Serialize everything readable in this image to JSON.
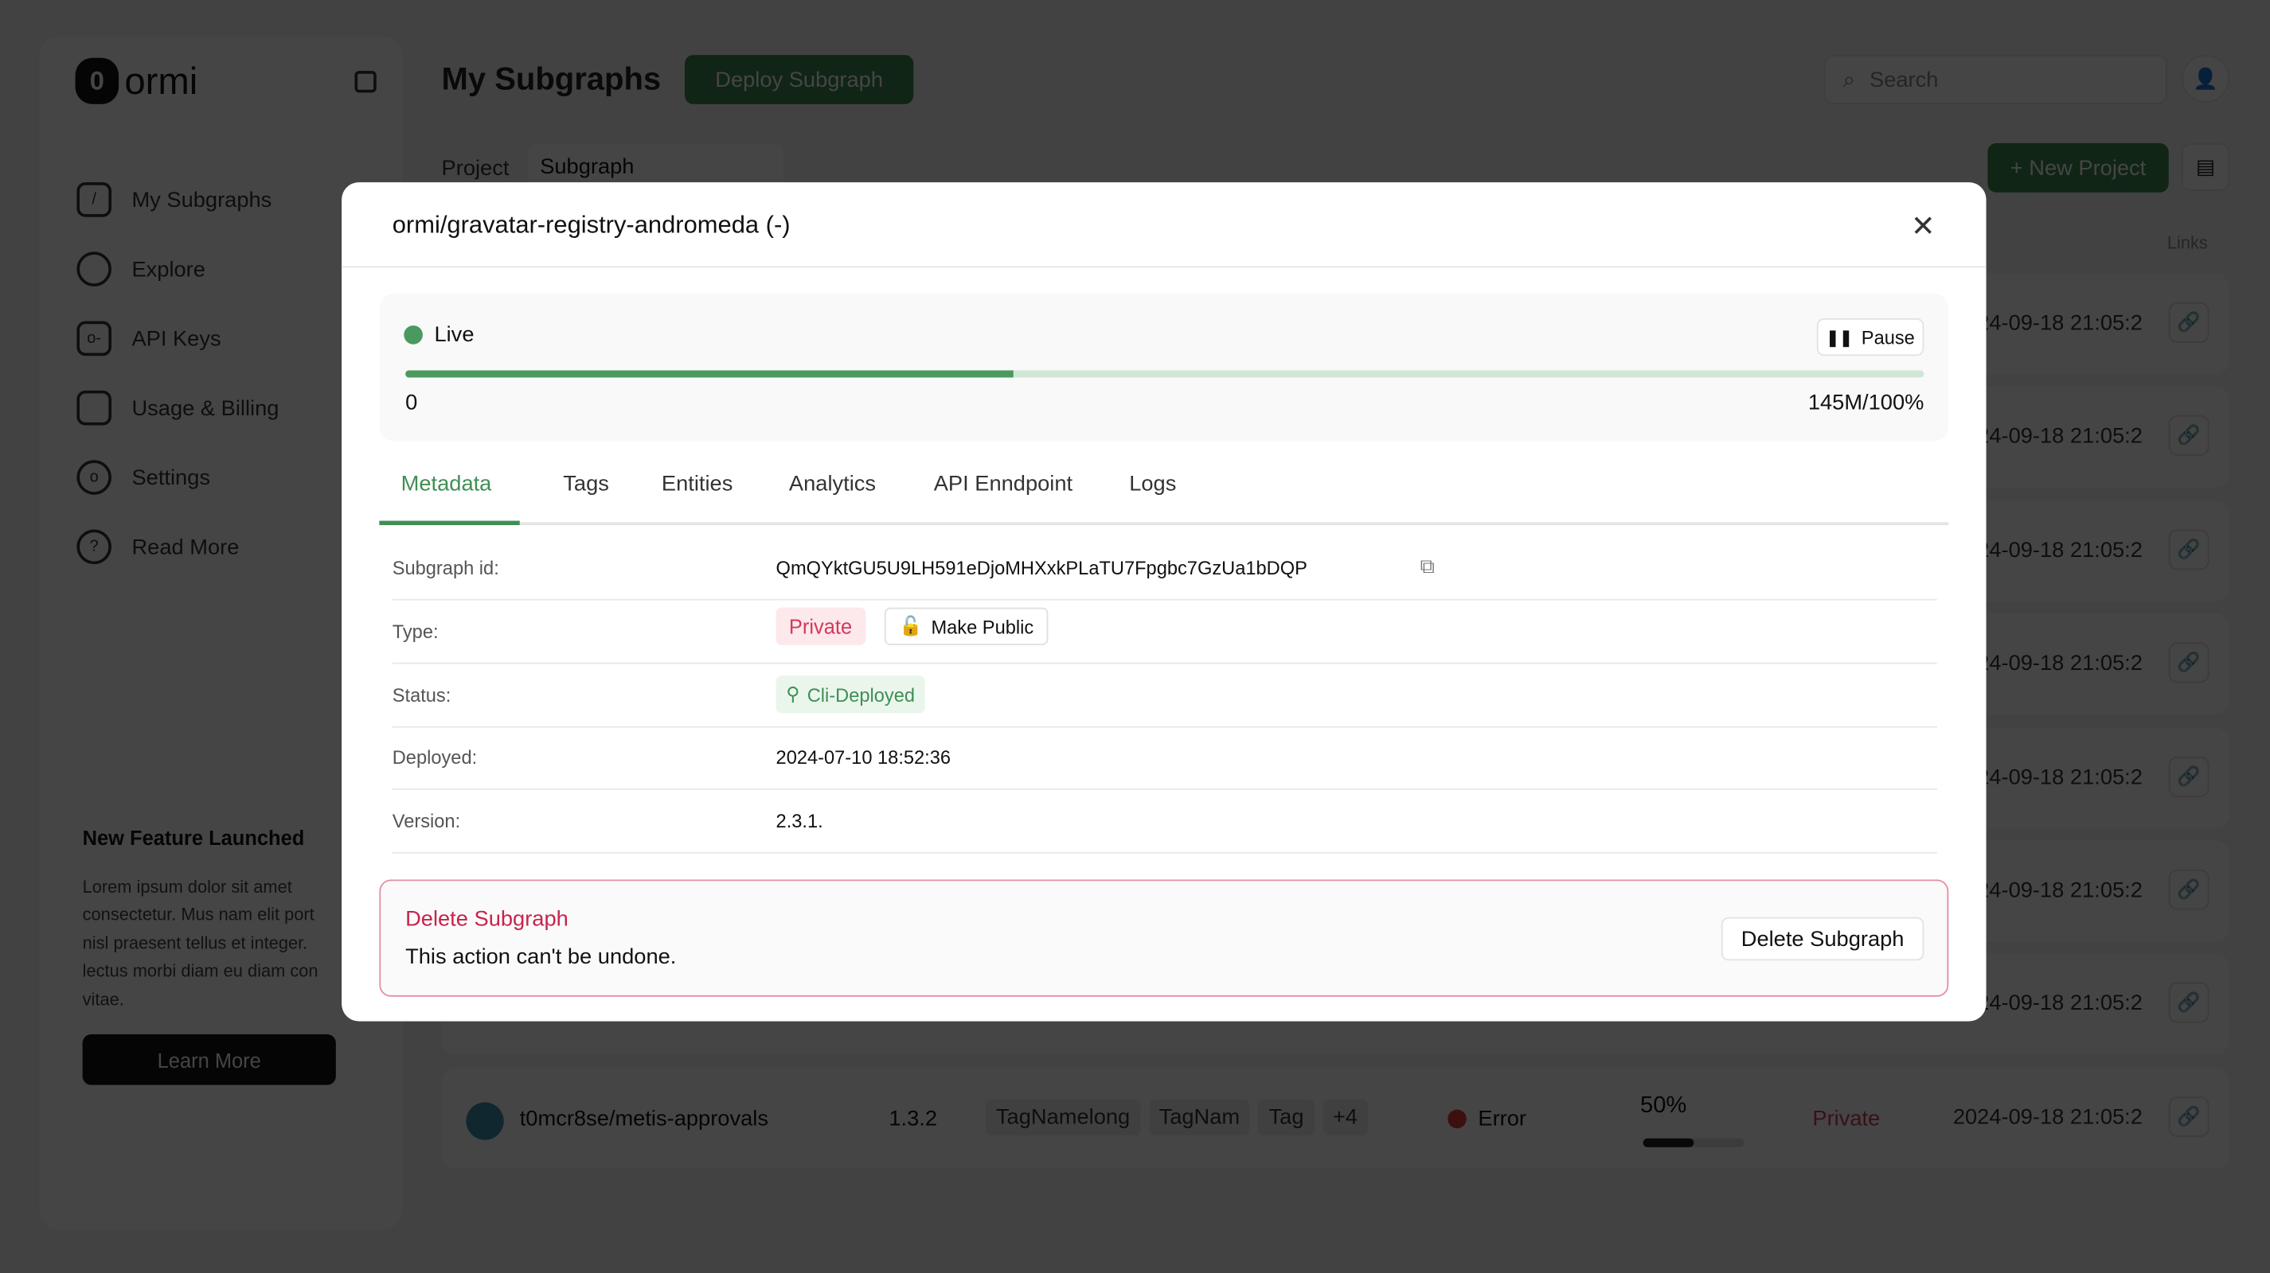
{
  "sidebar": {
    "logo": "ormi",
    "items": [
      {
        "label": "My Subgraphs",
        "icon": "code-icon"
      },
      {
        "label": "Explore",
        "icon": "search-icon"
      },
      {
        "label": "API Keys",
        "icon": "key-icon"
      },
      {
        "label": "Usage & Billing",
        "icon": "laptop-icon"
      },
      {
        "label": "Settings",
        "icon": "gear-icon"
      },
      {
        "label": "Read More",
        "icon": "help-icon"
      }
    ],
    "feature": {
      "title": "New Feature Launched",
      "text": "Lorem ipsum dolor sit amet consectetur. Mus nam elit port nisl praesent tellus et integer. lectus morbi diam eu diam con vitae.",
      "button": "Learn More"
    }
  },
  "header": {
    "title": "My Subgraphs",
    "deploy": "Deploy Subgraph",
    "search_placeholder": "Search",
    "project_label": "Project",
    "project_value": "Subgraph",
    "new_project": "+ New Project",
    "links_header": "Links"
  },
  "rows": {
    "date": "2024-09-18 21:05:2",
    "last": {
      "name": "t0mcr8se/metis-approvals",
      "version": "1.3.2",
      "tags": [
        "TagNamelong",
        "TagNam",
        "Tag",
        "+4"
      ],
      "status": "Error",
      "progress": "50%",
      "type": "Private",
      "date": "2024-09-18 21:05:2"
    }
  },
  "modal": {
    "title": "ormi/gravatar-registry-andromeda (-)",
    "status": "Live",
    "pause": "Pause",
    "progress_fraction": 0.4,
    "start": "0",
    "end": "145M/100%",
    "tabs": [
      "Metadata",
      "Tags",
      "Entities",
      "Analytics",
      "API Enndpoint",
      "Logs"
    ],
    "meta": {
      "id_label": "Subgraph id:",
      "id": "QmQYktGU5U9LH591eDjoMHXxkPLaTU7Fpgbc7GzUa1bDQP",
      "type_label": "Type:",
      "type": "Private",
      "make_public": "Make Public",
      "status_label": "Status:",
      "status": "Cli-Deployed",
      "deployed_label": "Deployed:",
      "deployed": "2024-07-10 18:52:36",
      "version_label": "Version:",
      "version": "2.3.1."
    },
    "danger": {
      "title": "Delete Subgraph",
      "text": "This action can't be undone.",
      "button": "Delete Subgraph"
    }
  },
  "colors": {
    "accent": "#3f8f55",
    "danger": "#c8234a"
  }
}
